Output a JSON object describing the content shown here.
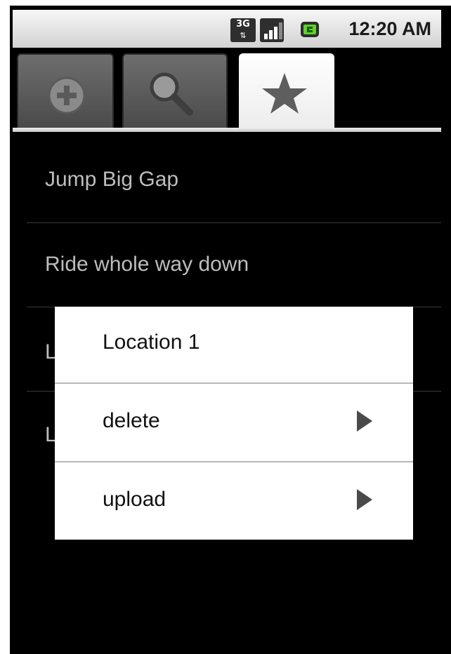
{
  "status_bar": {
    "network": "3G",
    "time": "12:20 AM"
  },
  "tabs": [
    {
      "icon": "add-icon",
      "active": false
    },
    {
      "icon": "search-icon",
      "active": false
    },
    {
      "icon": "star-icon",
      "active": true
    }
  ],
  "list": {
    "items": [
      {
        "label": "Jump Big Gap"
      },
      {
        "label": "Ride whole way down"
      },
      {
        "label": "L"
      },
      {
        "label": "L"
      }
    ]
  },
  "context_menu": {
    "title": "Location 1",
    "items": [
      {
        "label": "delete"
      },
      {
        "label": "upload"
      }
    ]
  },
  "colors": {
    "background": "#000000",
    "list_text": "#bdbdbd",
    "menu_background": "#ffffff",
    "menu_text": "#111111"
  }
}
